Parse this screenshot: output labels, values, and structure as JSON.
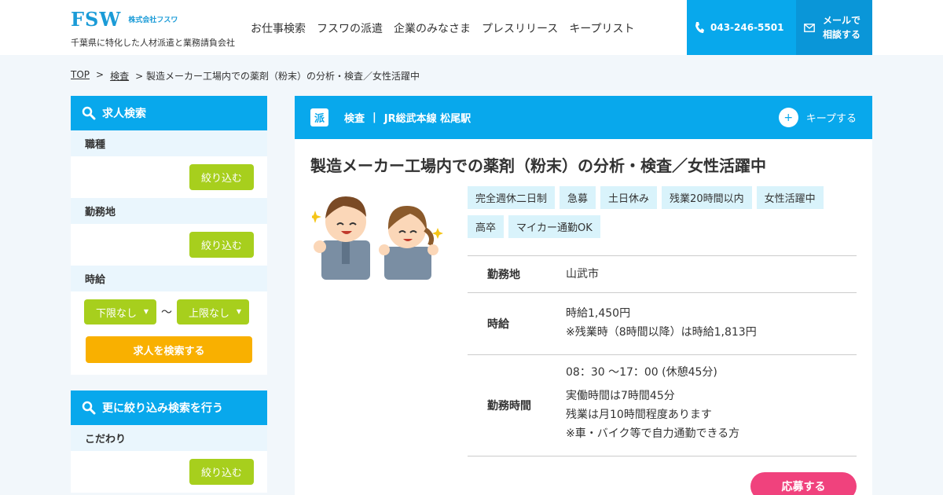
{
  "header": {
    "logo_mark": "FSW",
    "logo_name": "株式会社フスワ",
    "tagline": "千葉県に特化した人材派遣と業務請負会社",
    "nav": [
      "お仕事検索",
      "フスワの派遣",
      "企業のみなさま",
      "プレスリリース",
      "キープリスト"
    ],
    "tel": "043-246-5501",
    "mail_line1": "メールで",
    "mail_line2": "相談する"
  },
  "breadcrumb": {
    "top": "TOP",
    "sep1": ">",
    "category": "検査",
    "current": "> 製造メーカー工場内での薬剤（粉末）の分析・検査／女性活躍中"
  },
  "sidebar": {
    "search_head": "求人検索",
    "job_type_label": "職種",
    "location_label": "勤務地",
    "time_label": "時給",
    "narrow_label": "絞り込む",
    "min_select": "下限なし",
    "max_select": "上限なし",
    "tilde": "〜",
    "search_button": "求人を検索する",
    "refine_head": "更に絞り込み検索を行う",
    "kodawari_label": "こだわり"
  },
  "job": {
    "haken_badge": "派",
    "category": "検査",
    "sep": "|",
    "station": "JR総武本線 松尾駅",
    "keep_label": "キープする",
    "title": "製造メーカー工場内での薬剤（粉末）の分析・検査／女性活躍中",
    "tags": [
      "完全週休二日制",
      "急募",
      "土日休み",
      "残業20時間以内",
      "女性活躍中",
      "高卒",
      "マイカー通勤OK"
    ],
    "location_key": "勤務地",
    "location_val": "山武市",
    "wage_key": "時給",
    "wage_line1": "時給1,450円",
    "wage_line2": "※残業時（8時間以降）は時給1,813円",
    "hours_key": "勤務時間",
    "hours_line1": "08：30 〜17：00 (休憩45分)",
    "hours_line2": "実働時間は7時間45分",
    "hours_line3": "残業は月10時間程度あります",
    "hours_line4": "※車・バイク等で自力通勤できる方",
    "apply_label": "応募する"
  },
  "colors": {
    "primary_blue": "#08a8ec",
    "lime": "#a7cf1d",
    "orange": "#f9b000",
    "pink": "#f0427d",
    "tag_bg": "#d9f3fb"
  }
}
